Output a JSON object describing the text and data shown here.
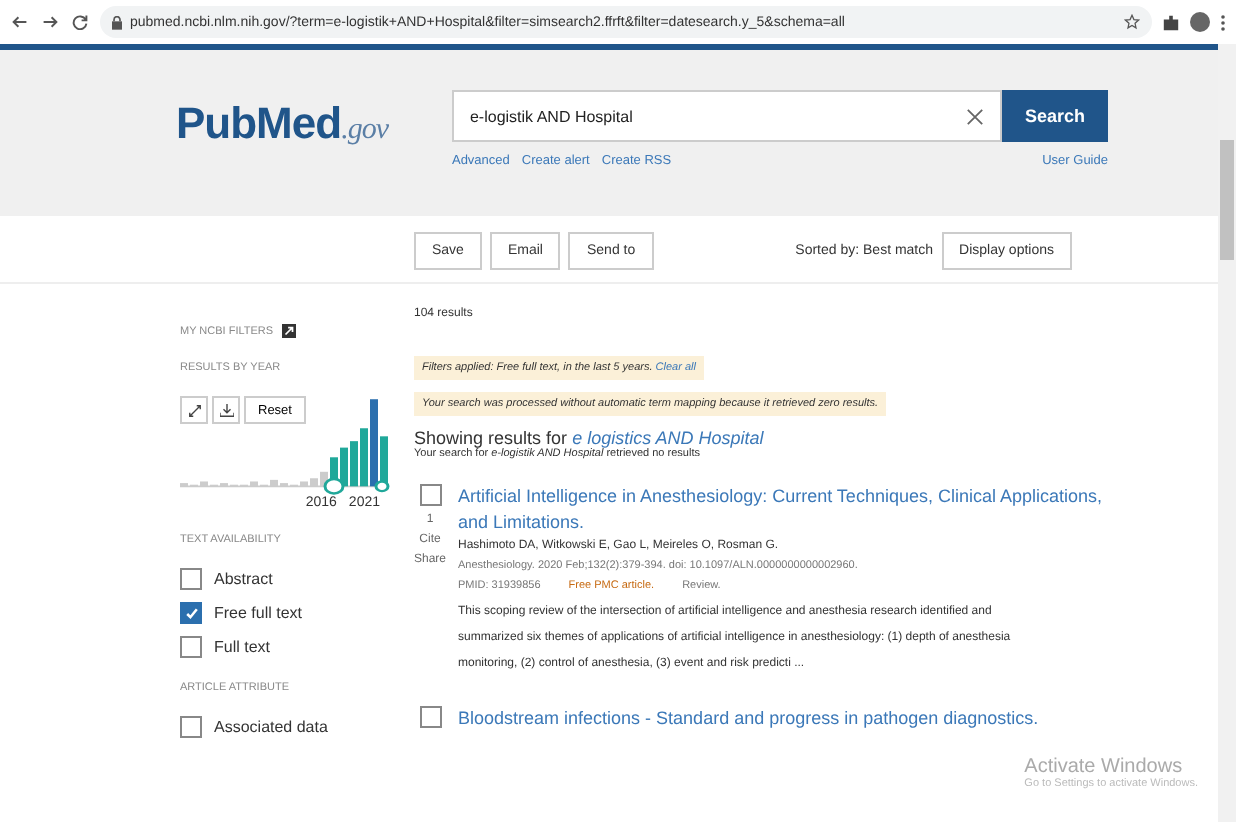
{
  "browser": {
    "url": "pubmed.ncbi.nlm.nih.gov/?term=e-logistik+AND+Hospital&filter=simsearch2.ffrft&filter=datesearch.y_5&schema=all"
  },
  "header": {
    "logo": {
      "name": "PubMed",
      "suffix": ".gov"
    },
    "search": {
      "value": "e-logistik AND Hospital",
      "button": "Search"
    },
    "links": [
      "Advanced",
      "Create alert",
      "Create RSS"
    ],
    "user_guide": "User Guide"
  },
  "toolbar": {
    "buttons": [
      "Save",
      "Email",
      "Send to"
    ],
    "sort_label": "Sorted by: Best match",
    "display_options": "Display options"
  },
  "sidebar": {
    "my_ncbi_filters": "MY NCBI FILTERS",
    "results_by_year": "RESULTS BY YEAR",
    "reset": "Reset",
    "year_labels": [
      "2016",
      "2021"
    ],
    "text_availability": "TEXT AVAILABILITY",
    "text_filters": [
      {
        "label": "Abstract",
        "checked": false
      },
      {
        "label": "Free full text",
        "checked": true
      },
      {
        "label": "Full text",
        "checked": false
      }
    ],
    "article_attribute": "ARTICLE ATTRIBUTE",
    "attribute_filters": [
      {
        "label": "Associated data",
        "checked": false
      }
    ]
  },
  "main": {
    "count": "104 results",
    "filters_applied": "Filters applied: Free full text, in the last 5 years.",
    "clear_all": "Clear all",
    "notice": "Your search was processed without automatic term mapping because it retrieved zero results.",
    "showing": "Showing results for",
    "showing_query": "e logistics AND Hospital",
    "no_results": "Your search for *e-logistik AND Hospital* retrieved no results",
    "results": [
      {
        "checked": false,
        "number": "1",
        "actions": [
          "Cite",
          "Share"
        ],
        "title": "Artificial Intelligence in Anesthesiology: Current Techniques, Clinical Applications, and Limitations.",
        "authors": "Hashimoto DA, Witkowski E, Gao L, Meireles O, Rosman G.",
        "citation": "Anesthesiology. 2020 Feb;132(2):379-394. doi: 10.1097/ALN.0000000000002960.",
        "pmid": "PMID: 31939856",
        "free": "Free PMC article.",
        "type": "Review.",
        "snippet": "This scoping review of the intersection of artificial intelligence and anesthesia research identified and summarized six themes of applications of artificial intelligence in anesthesiology: (1) depth of anesthesia monitoring, (2) control of anesthesia, (3) event and risk predicti ..."
      },
      {
        "checked": false,
        "title": "Bloodstream infections - Standard and progress in pathogen diagnostics."
      }
    ]
  },
  "overlay": {
    "title": "Activate Windows",
    "subtitle": "Go to Settings to activate Windows."
  }
}
